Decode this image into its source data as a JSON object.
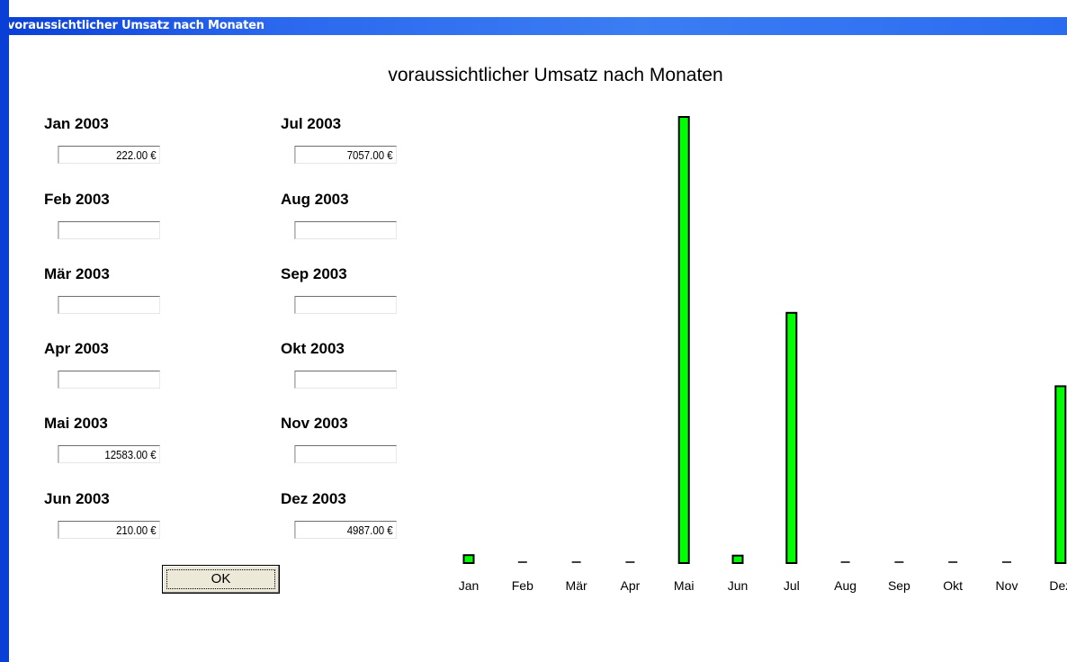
{
  "window": {
    "title": "voraussichtlicher Umsatz nach Monaten"
  },
  "heading": "voraussichtlicher Umsatz nach Monaten",
  "months": [
    {
      "label": "Jan 2003",
      "value": "222.00 €"
    },
    {
      "label": "Feb 2003",
      "value": ""
    },
    {
      "label": "Mär 2003",
      "value": ""
    },
    {
      "label": "Apr 2003",
      "value": ""
    },
    {
      "label": "Mai 2003",
      "value": "12583.00 €"
    },
    {
      "label": "Jun 2003",
      "value": "210.00 €"
    },
    {
      "label": "Jul 2003",
      "value": "7057.00 €"
    },
    {
      "label": "Aug 2003",
      "value": ""
    },
    {
      "label": "Sep 2003",
      "value": ""
    },
    {
      "label": "Okt 2003",
      "value": ""
    },
    {
      "label": "Nov 2003",
      "value": ""
    },
    {
      "label": "Dez 2003",
      "value": "4987.00 €"
    }
  ],
  "ok_button": {
    "label": "OK"
  },
  "chart_data": {
    "type": "bar",
    "categories": [
      "Jan",
      "Feb",
      "Mär",
      "Apr",
      "Mai",
      "Jun",
      "Jul",
      "Aug",
      "Sep",
      "Okt",
      "Nov",
      "Dez"
    ],
    "values": [
      222,
      0,
      0,
      0,
      12583,
      210,
      7057,
      0,
      0,
      0,
      0,
      4987
    ],
    "ylim": [
      0,
      12583
    ],
    "bar_color": "#00ff00",
    "grid": false
  },
  "colors": {
    "titlebar": "#0a3fd6",
    "bar": "#00ff00"
  }
}
